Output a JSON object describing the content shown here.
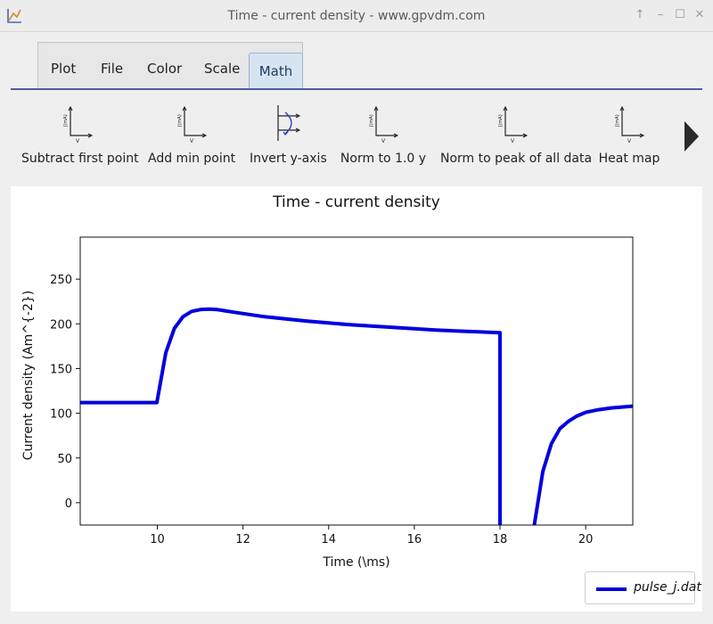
{
  "window": {
    "title": "Time - current density - www.gpvdm.com",
    "controls": [
      "↑",
      "–",
      "☐",
      "✕"
    ]
  },
  "tabs": [
    {
      "label": "Plot",
      "active": false
    },
    {
      "label": "File",
      "active": false
    },
    {
      "label": "Color",
      "active": false
    },
    {
      "label": "Scale",
      "active": false
    },
    {
      "label": "Math",
      "active": true
    }
  ],
  "toolbar": {
    "items": [
      {
        "label": "Subtract first point",
        "icon": "axes-icon"
      },
      {
        "label": "Add min point",
        "icon": "axes-icon"
      },
      {
        "label": "Invert y-axis",
        "icon": "invert-axis-icon"
      },
      {
        "label": "Norm to 1.0 y",
        "icon": "axes-icon"
      },
      {
        "label": "Norm to peak of all data",
        "icon": "axes-icon"
      },
      {
        "label": "Heat map",
        "icon": "axes-icon"
      }
    ],
    "more_icon": "right-arrow-icon"
  },
  "colors": {
    "series": "#0000e0",
    "tab_underline": "#4d5ea1"
  },
  "chart_data": {
    "type": "line",
    "title": "Time - current density",
    "xlabel": "Time (\\ms)",
    "ylabel": "Current density (Am^{-2})",
    "xlim": [
      8.2,
      21.1
    ],
    "ylim": [
      -25,
      297
    ],
    "xticks": [
      10,
      12,
      14,
      16,
      18,
      20
    ],
    "yticks": [
      0,
      50,
      100,
      150,
      200,
      250
    ],
    "grid": false,
    "legend_placement": "bottom-right",
    "series": [
      {
        "name": "pulse_j.dat",
        "x": [
          8.2,
          9.99,
          10.2,
          10.4,
          10.6,
          10.8,
          11.0,
          11.2,
          11.4,
          11.8,
          12.5,
          13.5,
          14.5,
          15.5,
          16.5,
          17.5,
          17.99,
          18.0,
          18.0
        ],
        "y": [
          112,
          112,
          168,
          195,
          208,
          214,
          216,
          216.5,
          216,
          213,
          208,
          203,
          199,
          196,
          193,
          191,
          190,
          190,
          -25
        ]
      },
      {
        "name": "pulse_j.dat",
        "x": [
          18.8,
          19.0,
          19.2,
          19.4,
          19.6,
          19.8,
          20.0,
          20.3,
          20.6,
          21.1
        ],
        "y": [
          -25,
          35,
          66,
          83,
          91,
          97,
          101,
          104,
          106,
          108
        ]
      }
    ]
  }
}
